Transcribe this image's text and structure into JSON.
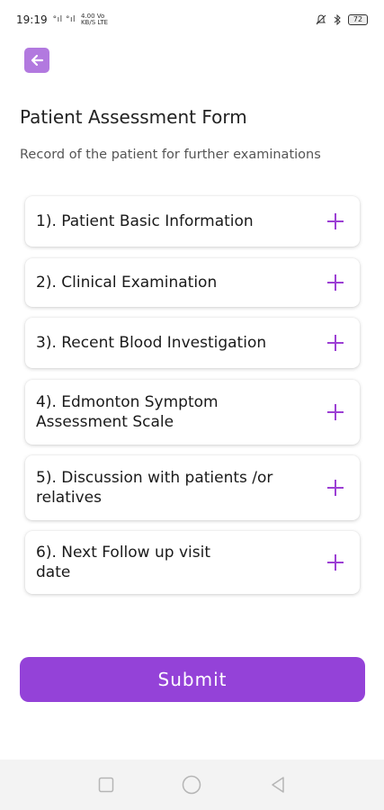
{
  "status_bar": {
    "time": "19:19",
    "signal_text": "°ıl °ıl",
    "network_text": "4.00 Vo\nKB/S LTE",
    "battery": "72"
  },
  "header": {
    "back_icon": "arrow-left-icon",
    "title": "Patient Assessment Form",
    "subtitle": "Record of the patient for further examinations"
  },
  "sections": [
    {
      "label": "1). Patient Basic Information"
    },
    {
      "label": "2). Clinical Examination"
    },
    {
      "label": "3). Recent Blood Investigation"
    },
    {
      "label": "4). Edmonton Symptom Assessment Scale"
    },
    {
      "label": "5). Discussion with patients /or relatives"
    },
    {
      "label": "6). Next Follow up visit date"
    }
  ],
  "submit_label": "Submit",
  "colors": {
    "accent": "#9442d8",
    "back_button": "#b279df",
    "plus": "#9c3fd4"
  }
}
